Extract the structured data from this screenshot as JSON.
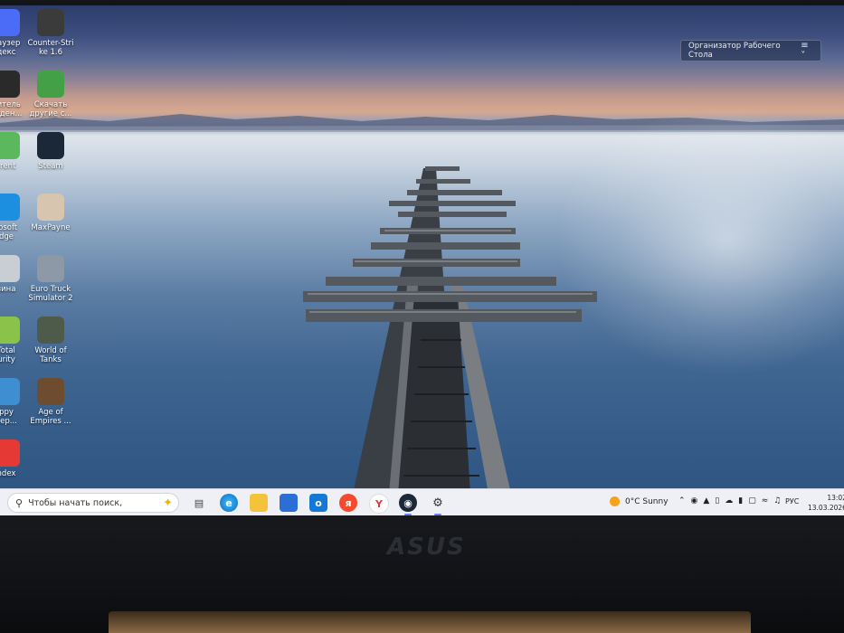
{
  "desktop": {
    "left_column": [
      {
        "label": "раузер\nдекс",
        "icon": "yandex-browser-icon",
        "color": "#4a6cf7"
      },
      {
        "label": "литель\nевден...",
        "icon": "xbox-icon",
        "color": "#2a2a2a"
      },
      {
        "label": "rrent",
        "icon": "utorrent-icon",
        "color": "#5cb85c"
      },
      {
        "label": "rosoft\ndge",
        "icon": "edge-icon",
        "color": "#1d8fe0"
      },
      {
        "label": "зина",
        "icon": "recycle-bin-icon",
        "color": "#c9cdd4"
      },
      {
        "label": "Total\nurity",
        "icon": "total-security-icon",
        "color": "#8bc34a"
      },
      {
        "label": "ppy\nвер...",
        "icon": "app-icon",
        "color": "#3d8fd1"
      },
      {
        "label": "ndex",
        "icon": "yandex-icon",
        "color": "#e53935"
      }
    ],
    "right_column": [
      {
        "label": "Counter-Stri\nke 1.6",
        "icon": "counter-strike-icon",
        "color": "#3b3b3b"
      },
      {
        "label": "Скачать\nдругие с...",
        "icon": "gamepad-icon",
        "color": "#43a047"
      },
      {
        "label": "Steam",
        "icon": "steam-icon",
        "color": "#1b2838"
      },
      {
        "label": "MaxPayne",
        "icon": "max-payne-icon",
        "color": "#d7c5b0"
      },
      {
        "label": "Euro Truck\nSimulator 2",
        "icon": "euro-truck-icon",
        "color": "#8d99a6"
      },
      {
        "label": "World of\nTanks",
        "icon": "world-of-tanks-icon",
        "color": "#4e5a4a"
      },
      {
        "label": "Age of\nEmpires ...",
        "icon": "age-of-empires-icon",
        "color": "#6d4c2f"
      }
    ]
  },
  "organizer": {
    "title": "Организатор Рабочего Стола",
    "menu": "≡ ˅"
  },
  "taskbar": {
    "search_placeholder": "Чтобы начать поиск,",
    "weather": "0°C  Sunny",
    "language": "РУС",
    "time": "13:02",
    "date": "13.03.2026"
  },
  "bezel": {
    "logo": "ASUS"
  }
}
